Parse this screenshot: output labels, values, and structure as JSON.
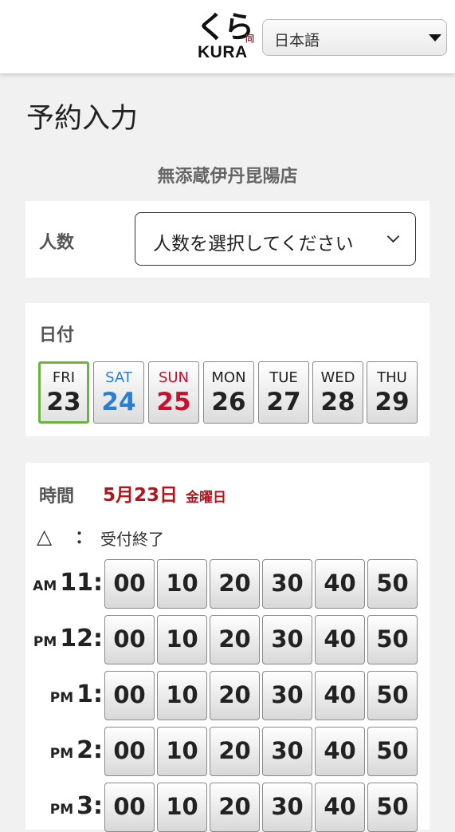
{
  "header": {
    "logo_kana": "くら",
    "logo_latin": "KURA",
    "logo_mark": "同",
    "language": "日本語"
  },
  "page_title": "予約入力",
  "store_name": "無添蔵伊丹昆陽店",
  "people": {
    "label": "人数",
    "placeholder": "人数を選択してください"
  },
  "date": {
    "label": "日付",
    "days": [
      {
        "dow": "FRI",
        "num": "23"
      },
      {
        "dow": "SAT",
        "num": "24"
      },
      {
        "dow": "SUN",
        "num": "25"
      },
      {
        "dow": "MON",
        "num": "26"
      },
      {
        "dow": "TUE",
        "num": "27"
      },
      {
        "dow": "WED",
        "num": "28"
      },
      {
        "dow": "THU",
        "num": "29"
      }
    ]
  },
  "time": {
    "label": "時間",
    "selected_date": "5月23日",
    "selected_dow": "金曜日",
    "legend_symbol": "△",
    "legend_colon": "：",
    "legend_text": "受付終了",
    "hours": [
      {
        "ampm": "AM",
        "hour": "11:"
      },
      {
        "ampm": "PM",
        "hour": "12:"
      },
      {
        "ampm": "PM",
        "hour": "1:"
      },
      {
        "ampm": "PM",
        "hour": "2:"
      },
      {
        "ampm": "PM",
        "hour": "3:"
      }
    ],
    "minutes": [
      "00",
      "10",
      "20",
      "30",
      "40",
      "50"
    ]
  }
}
